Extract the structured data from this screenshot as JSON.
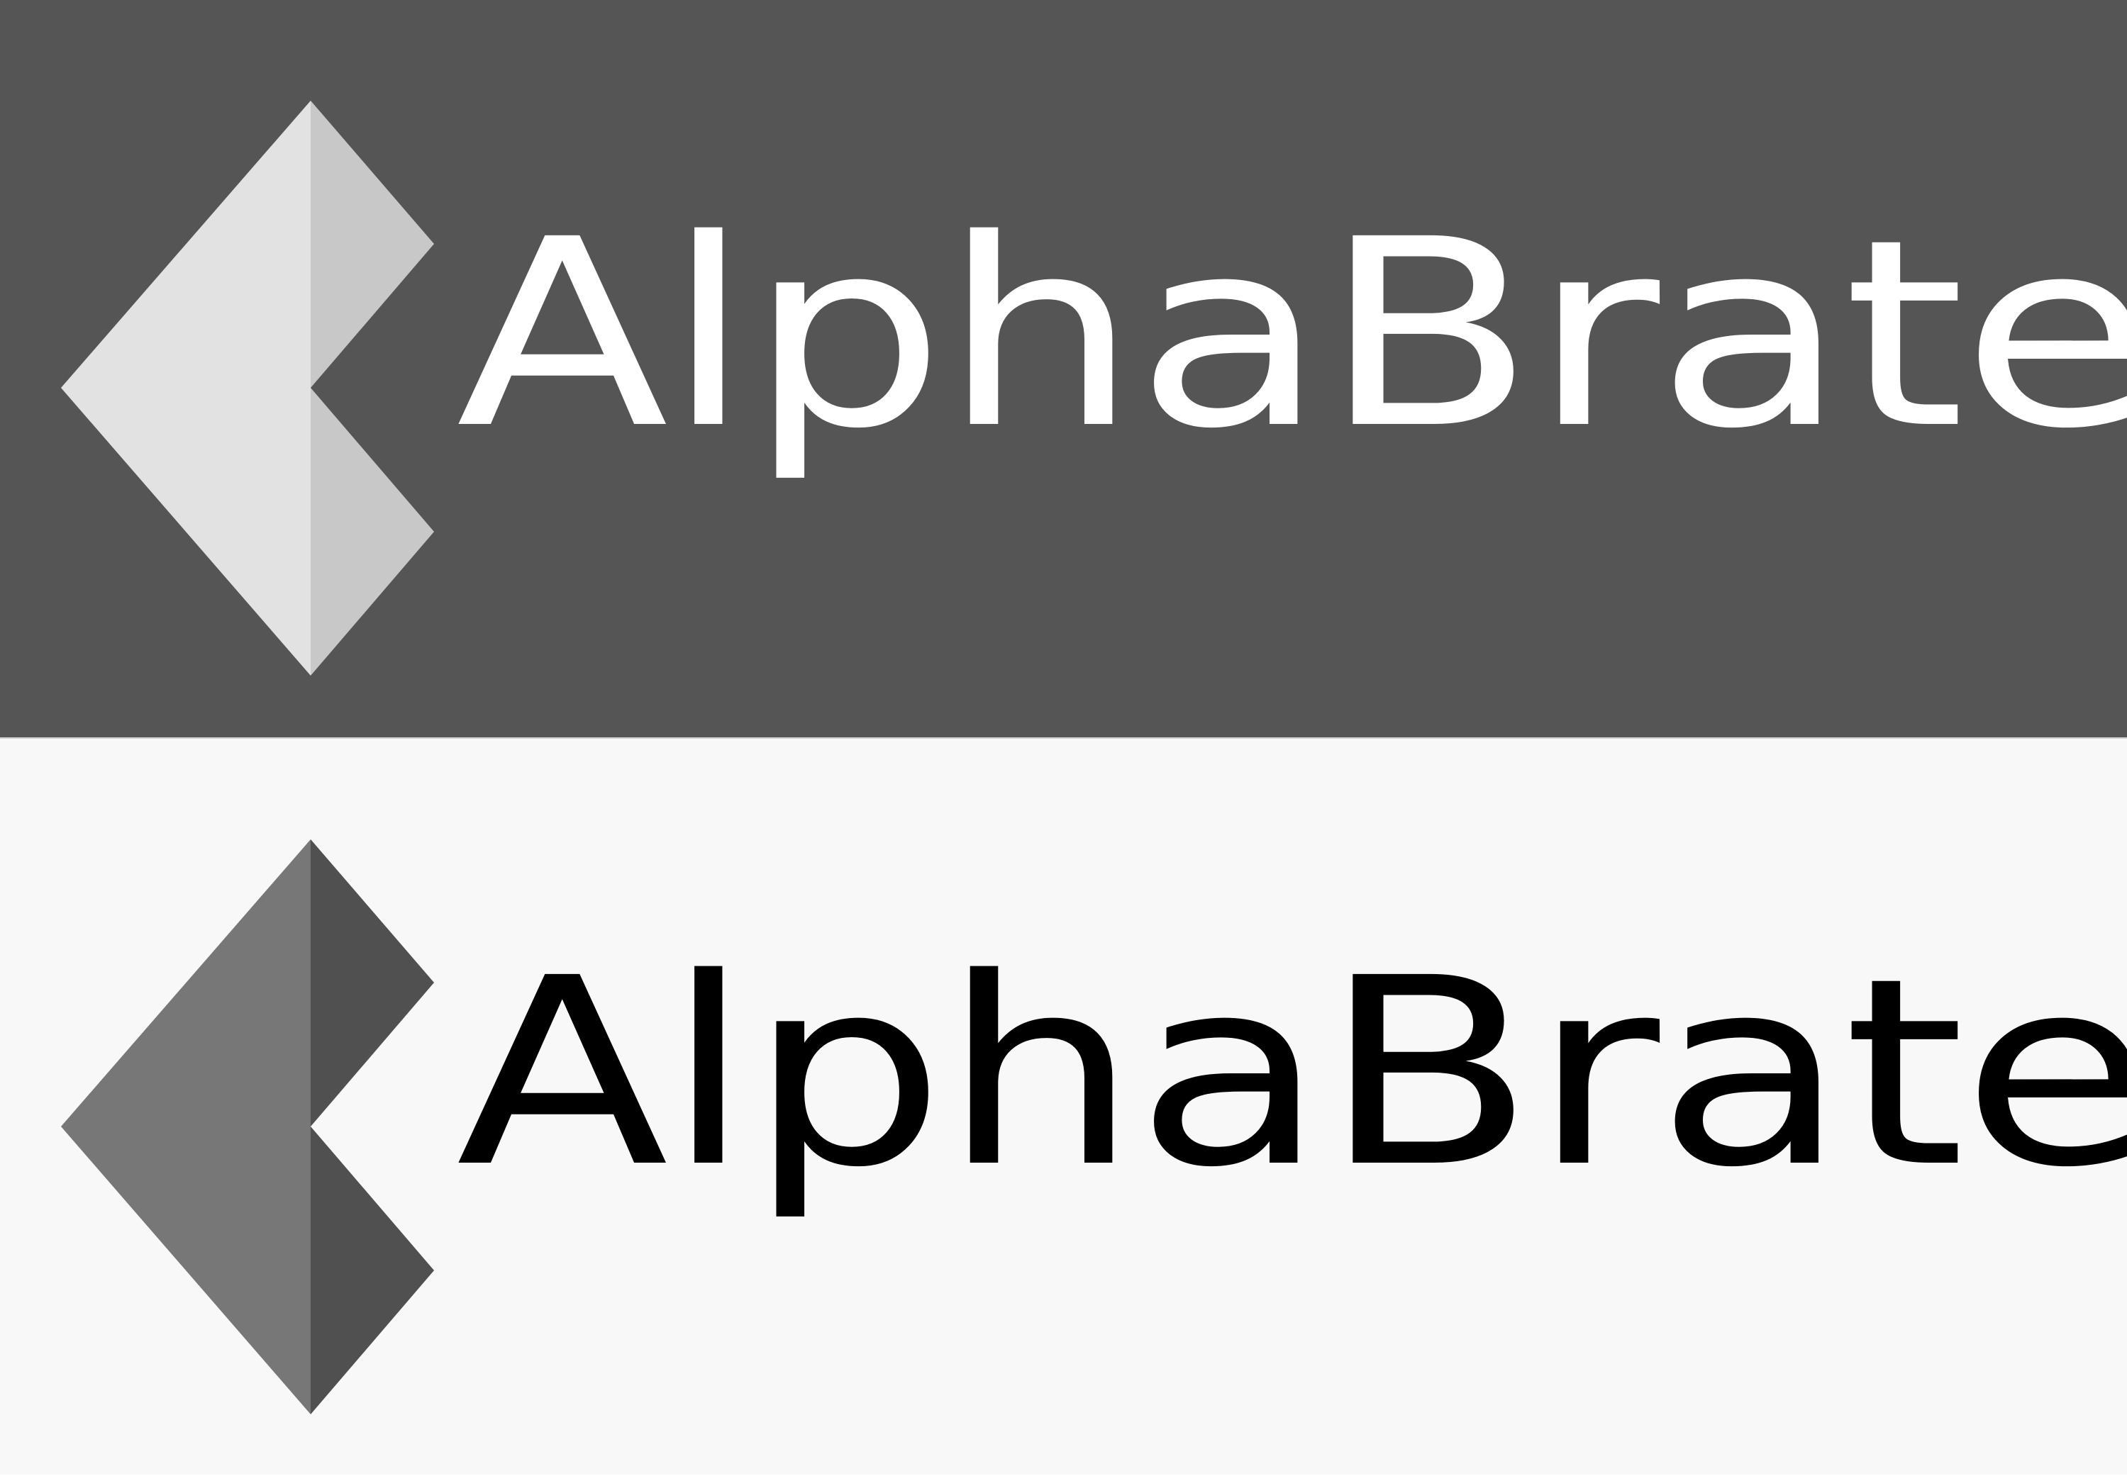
{
  "logo": {
    "wordmark": "AlphaBrate"
  },
  "variants": [
    {
      "name": "dark",
      "background": "#555555",
      "text_color": "#ffffff",
      "mark_left": "#e2e2e2",
      "mark_right": "#c8c8c8"
    },
    {
      "name": "light",
      "background": "#f8f8f8",
      "text_color": "#000000",
      "mark_left": "#777777",
      "mark_right": "#505050"
    }
  ]
}
